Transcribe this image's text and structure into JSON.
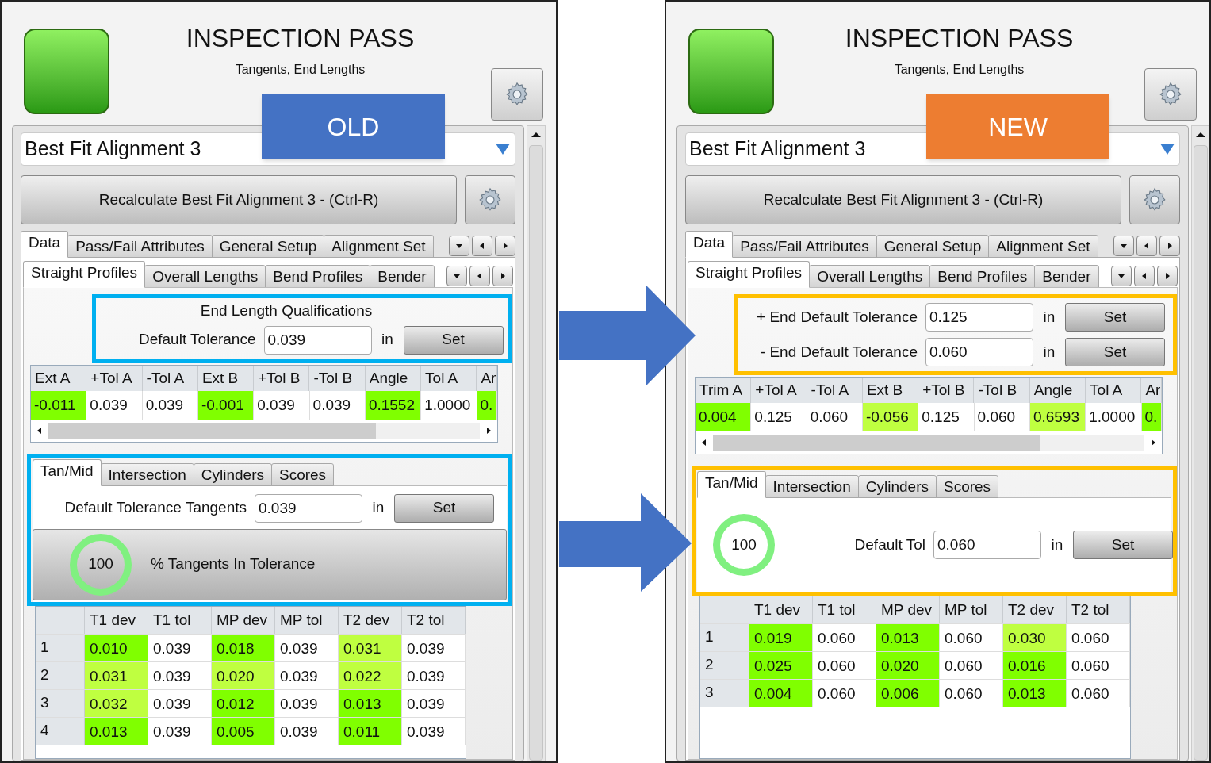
{
  "panels": [
    {
      "title": "INSPECTION PASS",
      "subtitle": "Tangents, End Lengths",
      "badge": {
        "label": "OLD",
        "color": "#4472c4"
      },
      "frame": {
        "color": "#00b0f0"
      },
      "alignment": "Best Fit Alignment 3",
      "recalculate": "Recalculate Best Fit Alignment 3 - (Ctrl-R)",
      "main_tabs": [
        {
          "label": "Data",
          "selected": true
        },
        {
          "label": "Pass/Fail Attributes",
          "selected": false
        },
        {
          "label": "General Setup",
          "selected": false
        },
        {
          "label": "Alignment Set",
          "selected": false
        }
      ],
      "sub_tabs": [
        {
          "label": "Straight Profiles",
          "selected": true
        },
        {
          "label": "Overall Lengths",
          "selected": false
        },
        {
          "label": "Bend Profiles",
          "selected": false
        },
        {
          "label": "Bender",
          "selected": false
        }
      ],
      "end_length": {
        "kind": "single",
        "title": "End Length Qualifications",
        "rows": [
          {
            "label": "Default Tolerance",
            "value": "0.039",
            "unit": "in",
            "button": "Set"
          }
        ]
      },
      "end_table": {
        "columns": [
          "Ext A",
          "+Tol A",
          "-Tol A",
          "Ext B",
          "+Tol B",
          "-Tol B",
          "Angle",
          "Tol A",
          "Ar"
        ],
        "cells": [
          {
            "text": "-0.011",
            "color": "#80ff00"
          },
          {
            "text": "0.039",
            "color": "#ffffff"
          },
          {
            "text": "0.039",
            "color": "#ffffff"
          },
          {
            "text": "-0.001",
            "color": "#80ff00"
          },
          {
            "text": "0.039",
            "color": "#ffffff"
          },
          {
            "text": "0.039",
            "color": "#ffffff"
          },
          {
            "text": "0.1552",
            "color": "#80ff00"
          },
          {
            "text": "1.0000",
            "color": "#ffffff"
          },
          {
            "text": "0.",
            "color": "#80ff00"
          }
        ]
      },
      "lower_tabs": [
        {
          "label": "Tan/Mid",
          "selected": true
        },
        {
          "label": "Intersection",
          "selected": false
        },
        {
          "label": "Cylinders",
          "selected": false
        },
        {
          "label": "Scores",
          "selected": false
        }
      ],
      "tangent": {
        "kind": "bar",
        "label": "Default Tolerance Tangents",
        "value": "0.039",
        "unit": "in",
        "button": "Set",
        "score": "100",
        "score_label": "% Tangents In Tolerance"
      },
      "tan_table": {
        "columns": [
          "T1 dev",
          "T1 tol",
          "MP dev",
          "MP tol",
          "T2 dev",
          "T2 tol"
        ],
        "rows": [
          {
            "index": "1",
            "cells": [
              {
                "text": "0.010",
                "color": "#80ff00"
              },
              {
                "text": "0.039",
                "color": "#ffffff"
              },
              {
                "text": "0.018",
                "color": "#80ff00"
              },
              {
                "text": "0.039",
                "color": "#ffffff"
              },
              {
                "text": "0.031",
                "color": "#bfff40"
              },
              {
                "text": "0.039",
                "color": "#ffffff"
              }
            ]
          },
          {
            "index": "2",
            "cells": [
              {
                "text": "0.031",
                "color": "#bfff40"
              },
              {
                "text": "0.039",
                "color": "#ffffff"
              },
              {
                "text": "0.020",
                "color": "#bfff40"
              },
              {
                "text": "0.039",
                "color": "#ffffff"
              },
              {
                "text": "0.022",
                "color": "#bfff40"
              },
              {
                "text": "0.039",
                "color": "#ffffff"
              }
            ]
          },
          {
            "index": "3",
            "cells": [
              {
                "text": "0.032",
                "color": "#bfff40"
              },
              {
                "text": "0.039",
                "color": "#ffffff"
              },
              {
                "text": "0.012",
                "color": "#80ff00"
              },
              {
                "text": "0.039",
                "color": "#ffffff"
              },
              {
                "text": "0.013",
                "color": "#80ff00"
              },
              {
                "text": "0.039",
                "color": "#ffffff"
              }
            ]
          },
          {
            "index": "4",
            "cells": [
              {
                "text": "0.013",
                "color": "#80ff00"
              },
              {
                "text": "0.039",
                "color": "#ffffff"
              },
              {
                "text": "0.005",
                "color": "#80ff00"
              },
              {
                "text": "0.039",
                "color": "#ffffff"
              },
              {
                "text": "0.011",
                "color": "#80ff00"
              },
              {
                "text": "0.039",
                "color": "#ffffff"
              }
            ]
          }
        ]
      }
    },
    {
      "title": "INSPECTION PASS",
      "subtitle": "Tangents, End Lengths",
      "badge": {
        "label": "NEW",
        "color": "#ed7d31"
      },
      "frame": {
        "color": "#ffc000"
      },
      "alignment": "Best Fit Alignment 3",
      "recalculate": "Recalculate Best Fit Alignment 3 - (Ctrl-R)",
      "main_tabs": [
        {
          "label": "Data",
          "selected": true
        },
        {
          "label": "Pass/Fail Attributes",
          "selected": false
        },
        {
          "label": "General Setup",
          "selected": false
        },
        {
          "label": "Alignment Set",
          "selected": false
        }
      ],
      "sub_tabs": [
        {
          "label": "Straight Profiles",
          "selected": true
        },
        {
          "label": "Overall Lengths",
          "selected": false
        },
        {
          "label": "Bend Profiles",
          "selected": false
        },
        {
          "label": "Bender",
          "selected": false
        }
      ],
      "end_length": {
        "kind": "double",
        "rows": [
          {
            "label": "+ End Default Tolerance",
            "value": "0.125",
            "unit": "in",
            "button": "Set"
          },
          {
            "label": "- End Default Tolerance",
            "value": "0.060",
            "unit": "in",
            "button": "Set"
          }
        ]
      },
      "end_table": {
        "columns": [
          "Trim A",
          "+Tol A",
          "-Tol A",
          "Ext B",
          "+Tol B",
          "-Tol B",
          "Angle",
          "Tol A",
          "Ar"
        ],
        "cells": [
          {
            "text": "0.004",
            "color": "#80ff00"
          },
          {
            "text": "0.125",
            "color": "#ffffff"
          },
          {
            "text": "0.060",
            "color": "#ffffff"
          },
          {
            "text": "-0.056",
            "color": "#bfff40"
          },
          {
            "text": "0.125",
            "color": "#ffffff"
          },
          {
            "text": "0.060",
            "color": "#ffffff"
          },
          {
            "text": "0.6593",
            "color": "#bfff40"
          },
          {
            "text": "1.0000",
            "color": "#ffffff"
          },
          {
            "text": "0.",
            "color": "#80ff00"
          }
        ]
      },
      "lower_tabs": [
        {
          "label": "Tan/Mid",
          "selected": true
        },
        {
          "label": "Intersection",
          "selected": false
        },
        {
          "label": "Cylinders",
          "selected": false
        },
        {
          "label": "Scores",
          "selected": false
        }
      ],
      "tangent": {
        "kind": "inline",
        "label": "Default Tol",
        "value": "0.060",
        "unit": "in",
        "button": "Set",
        "score": "100"
      },
      "tan_table": {
        "columns": [
          "T1 dev",
          "T1 tol",
          "MP dev",
          "MP tol",
          "T2 dev",
          "T2 tol"
        ],
        "rows": [
          {
            "index": "1",
            "cells": [
              {
                "text": "0.019",
                "color": "#80ff00"
              },
              {
                "text": "0.060",
                "color": "#ffffff"
              },
              {
                "text": "0.013",
                "color": "#80ff00"
              },
              {
                "text": "0.060",
                "color": "#ffffff"
              },
              {
                "text": "0.030",
                "color": "#bfff40"
              },
              {
                "text": "0.060",
                "color": "#ffffff"
              }
            ]
          },
          {
            "index": "2",
            "cells": [
              {
                "text": "0.025",
                "color": "#80ff00"
              },
              {
                "text": "0.060",
                "color": "#ffffff"
              },
              {
                "text": "0.020",
                "color": "#80ff00"
              },
              {
                "text": "0.060",
                "color": "#ffffff"
              },
              {
                "text": "0.016",
                "color": "#80ff00"
              },
              {
                "text": "0.060",
                "color": "#ffffff"
              }
            ]
          },
          {
            "index": "3",
            "cells": [
              {
                "text": "0.004",
                "color": "#80ff00"
              },
              {
                "text": "0.060",
                "color": "#ffffff"
              },
              {
                "text": "0.006",
                "color": "#80ff00"
              },
              {
                "text": "0.060",
                "color": "#ffffff"
              },
              {
                "text": "0.013",
                "color": "#80ff00"
              },
              {
                "text": "0.060",
                "color": "#ffffff"
              }
            ]
          }
        ]
      }
    }
  ]
}
